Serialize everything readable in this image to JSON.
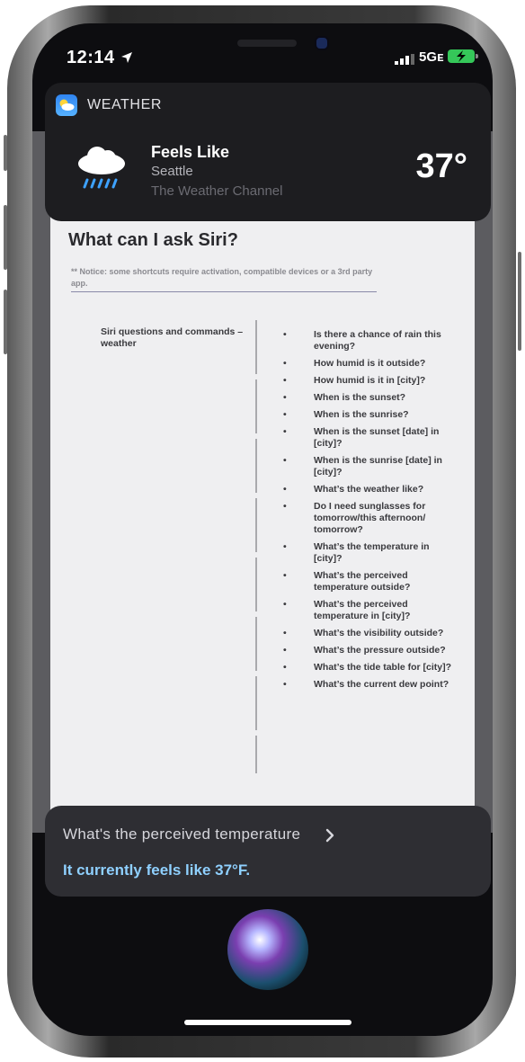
{
  "status_bar": {
    "time": "12:14",
    "network": "5Gᴇ"
  },
  "weather_card": {
    "app_name": "WEATHER",
    "title": "Feels Like",
    "city": "Seattle",
    "source": "The Weather Channel",
    "temperature": "37°"
  },
  "document": {
    "title": "What can I ask Siri?",
    "notice": "** Notice: some shortcuts require activation, compatible devices or a 3rd party app.",
    "left_label": "Siri questions and commands – weather",
    "questions": [
      "Is there a chance of rain this evening?",
      "How humid is it outside?",
      "How humid is it in [city]?",
      "When is the sunset?",
      "When is the sunrise?",
      "When is the sunset [date] in [city]?",
      "When is the sunrise [date] in [city]?",
      "What’s the weather like?",
      "Do I need sunglasses for tomorrow/this afternoon/ tomorrow?",
      "What’s the temperature in [city]?",
      "What’s the perceived temperature outside?",
      "What’s the perceived temperature in [city]?",
      "What’s the visibility outside?",
      "What’s the pressure outside?",
      "What’s the tide table for [city]?",
      "What’s the current dew point?"
    ]
  },
  "siri": {
    "query": "What's the perceived temperature",
    "answer": "It currently feels like 37°F."
  },
  "colors": {
    "card_bg": "#1d1d20",
    "answer_text": "#8fd0ff",
    "battery": "#35c759"
  },
  "icons": [
    "location-arrow-icon",
    "signal-bars-icon",
    "battery-charging-icon",
    "weather-app-icon",
    "rain-cloud-icon",
    "chevron-right-icon",
    "siri-orb-icon"
  ]
}
